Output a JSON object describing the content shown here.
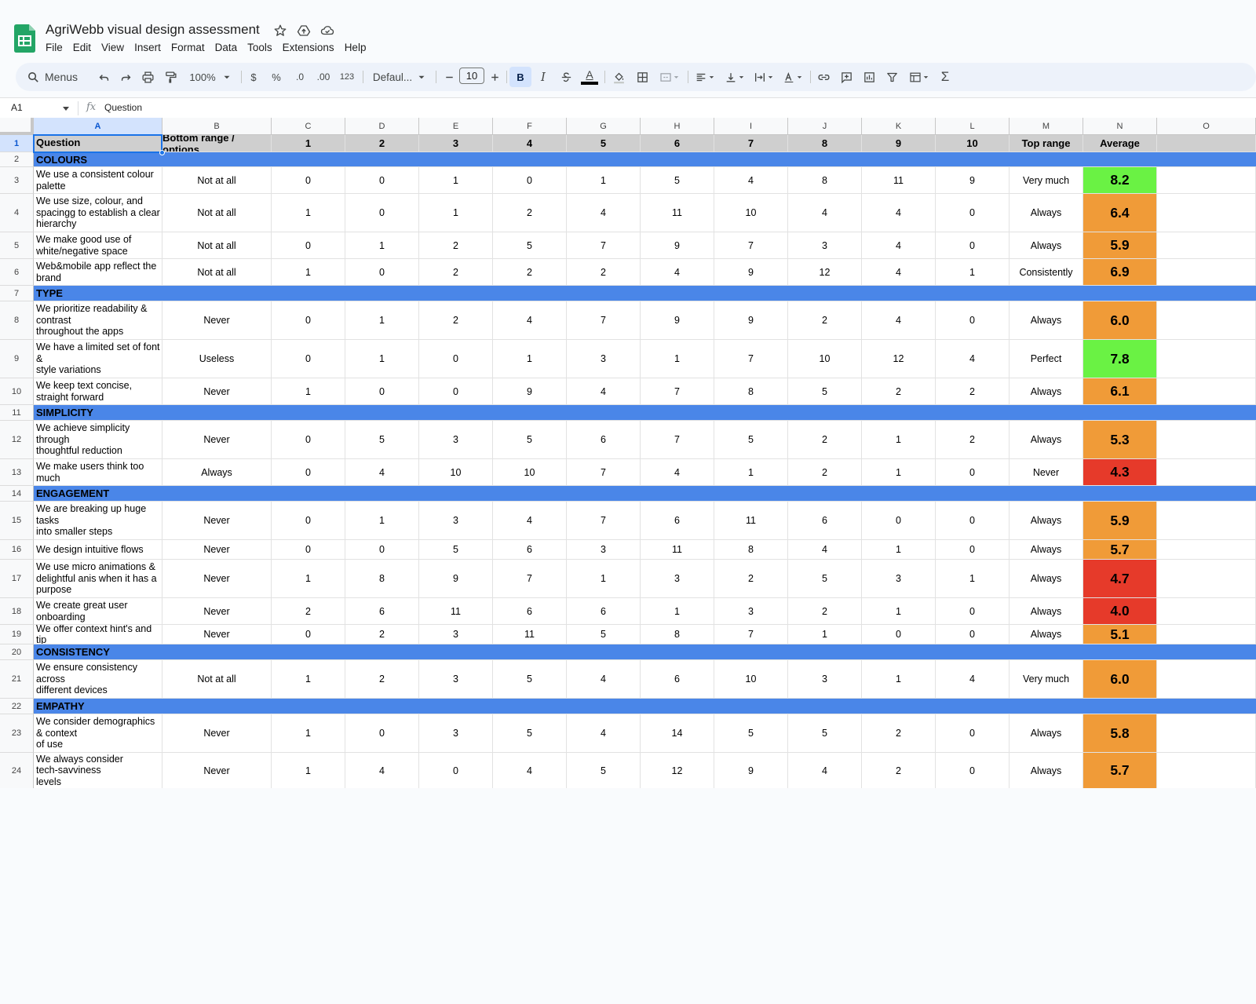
{
  "document": {
    "title": "AgriWebb visual design assessment"
  },
  "menu": [
    "File",
    "Edit",
    "View",
    "Insert",
    "Format",
    "Data",
    "Tools",
    "Extensions",
    "Help"
  ],
  "toolbar": {
    "menus_label": "Menus",
    "zoom": "100%",
    "currency": "$",
    "percent": "%",
    "decrease_decimal": ".0",
    "increase_decimal": ".00",
    "number_format": "123",
    "font": "Defaul...",
    "font_size": "10",
    "bold": "B",
    "italic": "I",
    "text_color_letter": "A",
    "sum": "Σ"
  },
  "formula_bar": {
    "cell_ref": "A1",
    "fx": "fx",
    "content": "Question"
  },
  "colors": {
    "category": "#4a86e8",
    "high": "#6af244",
    "mid": "#f09b38",
    "low": "#e63a2a",
    "header": "#cfcfcf"
  },
  "columns": [
    "A",
    "B",
    "C",
    "D",
    "E",
    "F",
    "G",
    "H",
    "I",
    "J",
    "K",
    "L",
    "M",
    "N",
    "O"
  ],
  "rows": [
    {
      "num": "1",
      "type": "header",
      "cells": [
        "Question",
        "Bottom range / options",
        "1",
        "2",
        "3",
        "4",
        "5",
        "6",
        "7",
        "8",
        "9",
        "10",
        "Top range",
        "Average"
      ]
    },
    {
      "num": "2",
      "type": "category",
      "label": "COLOURS"
    },
    {
      "num": "3",
      "type": "data",
      "q": "We use a consistent colour\npalette",
      "b": "Not at all",
      "v": [
        "0",
        "0",
        "1",
        "0",
        "1",
        "5",
        "4",
        "8",
        "11",
        "9"
      ],
      "top": "Very much",
      "avg": "8.2",
      "color": "high"
    },
    {
      "num": "4",
      "type": "data",
      "q": "We use size, colour, and\nspacingg to establish a clear\nhierarchy",
      "b": "Not at all",
      "v": [
        "1",
        "0",
        "1",
        "2",
        "4",
        "11",
        "10",
        "4",
        "4",
        "0"
      ],
      "top": "Always",
      "avg": "6.4",
      "color": "mid"
    },
    {
      "num": "5",
      "type": "data",
      "q": "We make good use of\nwhite/negative space",
      "b": "Not at all",
      "v": [
        "0",
        "1",
        "2",
        "5",
        "7",
        "9",
        "7",
        "3",
        "4",
        "0"
      ],
      "top": "Always",
      "avg": "5.9",
      "color": "mid"
    },
    {
      "num": "6",
      "type": "data",
      "q": "Web&mobile app reflect the\nbrand",
      "b": "Not at all",
      "v": [
        "1",
        "0",
        "2",
        "2",
        "2",
        "4",
        "9",
        "12",
        "4",
        "1"
      ],
      "top": "Consistently",
      "avg": "6.9",
      "color": "mid"
    },
    {
      "num": "7",
      "type": "category",
      "label": "TYPE"
    },
    {
      "num": "8",
      "type": "data",
      "q": "We prioritize readability &\ncontrast\nthroughout the apps",
      "b": "Never",
      "v": [
        "0",
        "1",
        "2",
        "4",
        "7",
        "9",
        "9",
        "2",
        "4",
        "0"
      ],
      "top": "Always",
      "avg": "6.0",
      "color": "mid"
    },
    {
      "num": "9",
      "type": "data",
      "q": "We have a limited set of font\n&\nstyle variations",
      "b": "Useless",
      "v": [
        "0",
        "1",
        "0",
        "1",
        "3",
        "1",
        "7",
        "10",
        "12",
        "4"
      ],
      "top": "Perfect",
      "avg": "7.8",
      "color": "high"
    },
    {
      "num": "10",
      "type": "data",
      "q": "We keep text concise,\nstraight forward",
      "b": "Never",
      "v": [
        "1",
        "0",
        "0",
        "9",
        "4",
        "7",
        "8",
        "5",
        "2",
        "2"
      ],
      "top": "Always",
      "avg": "6.1",
      "color": "mid"
    },
    {
      "num": "11",
      "type": "category",
      "label": "SIMPLICITY"
    },
    {
      "num": "12",
      "type": "data",
      "q": "We achieve simplicity\nthrough\nthoughtful reduction",
      "b": "Never",
      "v": [
        "0",
        "5",
        "3",
        "5",
        "6",
        "7",
        "5",
        "2",
        "1",
        "2"
      ],
      "top": "Always",
      "avg": "5.3",
      "color": "mid"
    },
    {
      "num": "13",
      "type": "data",
      "q": " We make users think too\nmuch",
      "b": "Always",
      "v": [
        "0",
        "4",
        "10",
        "10",
        "7",
        "4",
        "1",
        "2",
        "1",
        "0"
      ],
      "top": "Never",
      "avg": "4.3",
      "color": "low"
    },
    {
      "num": "14",
      "type": "category",
      "label": "ENGAGEMENT"
    },
    {
      "num": "15",
      "type": "data",
      "q": "We are breaking up huge\ntasks\ninto smaller steps",
      "b": "Never",
      "v": [
        "0",
        "1",
        "3",
        "4",
        "7",
        "6",
        "11",
        "6",
        "0",
        "0"
      ],
      "top": "Always",
      "avg": "5.9",
      "color": "mid"
    },
    {
      "num": "16",
      "type": "data",
      "q": "We design intuitive flows",
      "b": "Never",
      "v": [
        "0",
        "0",
        "5",
        "6",
        "3",
        "11",
        "8",
        "4",
        "1",
        "0"
      ],
      "top": "Always",
      "avg": "5.7",
      "color": "mid"
    },
    {
      "num": "17",
      "type": "data",
      "q": "We use micro animations &\ndelightful anis when it has a\npurpose",
      "b": "Never",
      "v": [
        "1",
        "8",
        "9",
        "7",
        "1",
        "3",
        "2",
        "5",
        "3",
        "1"
      ],
      "top": "Always",
      "avg": "4.7",
      "color": "low"
    },
    {
      "num": "18",
      "type": "data",
      "q": "We create great user\nonboarding",
      "b": "Never",
      "v": [
        "2",
        "6",
        "11",
        "6",
        "6",
        "1",
        "3",
        "2",
        "1",
        "0"
      ],
      "top": "Always",
      "avg": "4.0",
      "color": "low"
    },
    {
      "num": "19",
      "type": "data",
      "q": "We offer context hint's and tip",
      "b": "Never",
      "v": [
        "0",
        "2",
        "3",
        "11",
        "5",
        "8",
        "7",
        "1",
        "0",
        "0"
      ],
      "top": "Always",
      "avg": "5.1",
      "color": "mid"
    },
    {
      "num": "20",
      "type": "category",
      "label": "CONSISTENCY"
    },
    {
      "num": "21",
      "type": "data",
      "q": "We ensure consistency\nacross\ndifferent devices",
      "b": "Not at all",
      "v": [
        "1",
        "2",
        "3",
        "5",
        "4",
        "6",
        "10",
        "3",
        "1",
        "4"
      ],
      "top": "Very much",
      "avg": "6.0",
      "color": "mid"
    },
    {
      "num": "22",
      "type": "category",
      "label": "EMPATHY"
    },
    {
      "num": "23",
      "type": "data",
      "q": "We consider demographics\n& context\nof use",
      "b": "Never",
      "v": [
        "1",
        "0",
        "3",
        "5",
        "4",
        "14",
        "5",
        "5",
        "2",
        "0"
      ],
      "top": "Always",
      "avg": "5.8",
      "color": "mid"
    },
    {
      "num": "24",
      "type": "data",
      "q": "We always consider\ntech-savviness\nlevels",
      "b": "Never",
      "v": [
        "1",
        "4",
        "0",
        "4",
        "5",
        "12",
        "9",
        "4",
        "2",
        "0"
      ],
      "top": "Always",
      "avg": "5.7",
      "color": "mid"
    }
  ]
}
